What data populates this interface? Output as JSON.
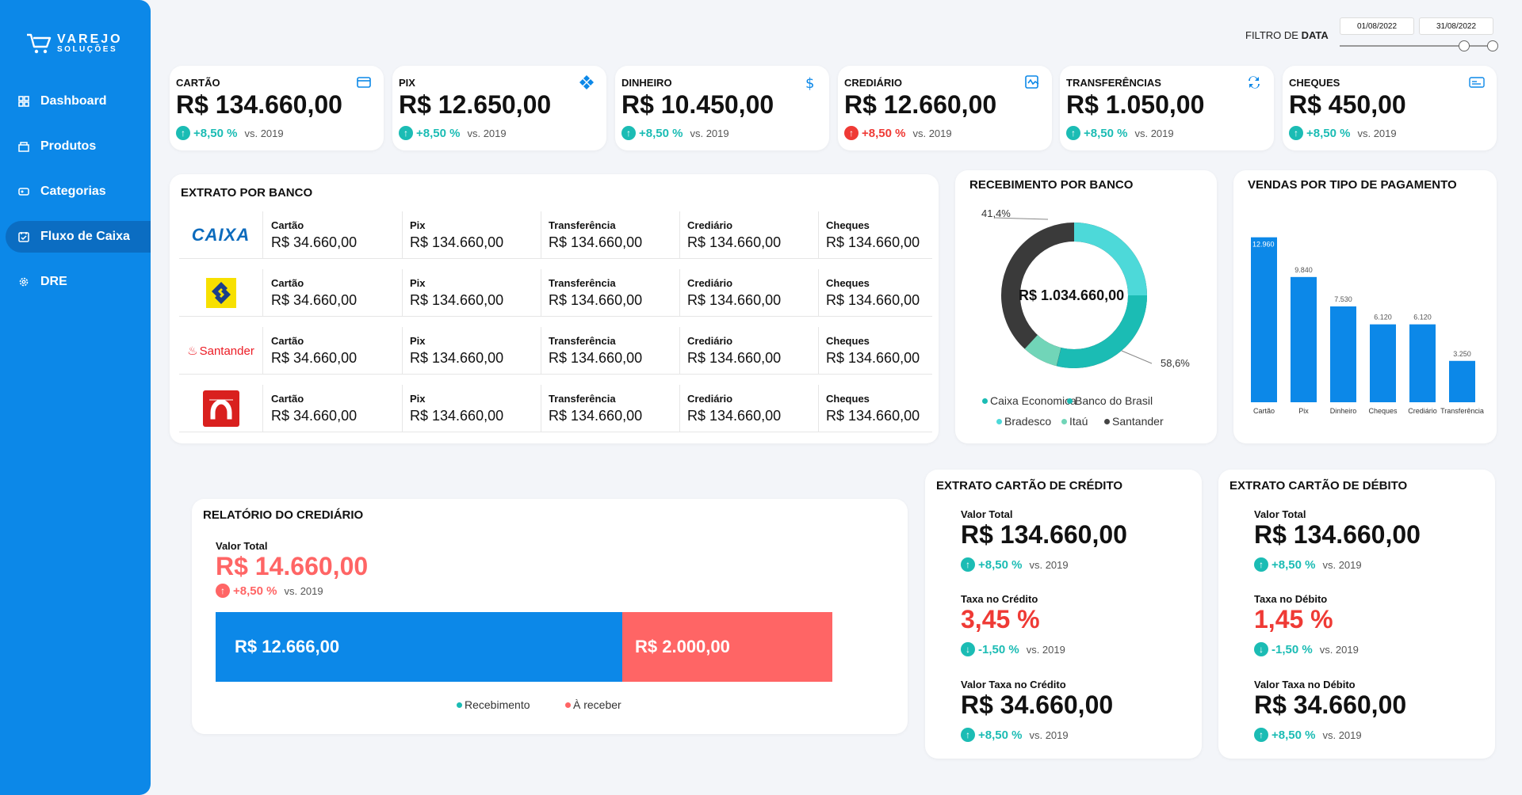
{
  "brand": {
    "line1": "VAREJO",
    "line2": "SOLUÇÕES"
  },
  "nav": [
    {
      "label": "Dashboard",
      "icon": "grid-icon"
    },
    {
      "label": "Produtos",
      "icon": "box-icon"
    },
    {
      "label": "Categorias",
      "icon": "tag-icon"
    },
    {
      "label": "Fluxo de Caixa",
      "icon": "calendar-icon",
      "active": true
    },
    {
      "label": "DRE",
      "icon": "gear-icon"
    }
  ],
  "filter": {
    "label_prefix": "FILTRO DE",
    "label_bold": "DATA",
    "start": "01/08/2022",
    "end": "31/08/2022"
  },
  "kpis": [
    {
      "label": "CARTÃO",
      "value": "R$ 134.660,00",
      "trend": "+8,50 %",
      "direction": "up",
      "vs": "vs. 2019",
      "icon": "credit-card-icon"
    },
    {
      "label": "PIX",
      "value": "R$ 12.650,00",
      "trend": "+8,50 %",
      "direction": "up",
      "vs": "vs. 2019",
      "icon": "pix-icon"
    },
    {
      "label": "DINHEIRO",
      "value": "R$ 10.450,00",
      "trend": "+8,50 %",
      "direction": "up",
      "vs": "vs. 2019",
      "icon": "dollar-icon"
    },
    {
      "label": "CREDIÁRIO",
      "value": "R$ 12.660,00",
      "trend": "+8,50 %",
      "direction": "red",
      "vs": "vs. 2019",
      "icon": "signature-icon"
    },
    {
      "label": "TRANSFERÊNCIAS",
      "value": "R$ 1.050,00",
      "trend": "+8,50 %",
      "direction": "up",
      "vs": "vs. 2019",
      "icon": "transfer-icon"
    },
    {
      "label": "CHEQUES",
      "value": "R$ 450,00",
      "trend": "+8,50 %",
      "direction": "up",
      "vs": "vs. 2019",
      "icon": "check-icon"
    }
  ],
  "extrato_banco": {
    "title": "EXTRATO POR BANCO",
    "columns": [
      "Cartão",
      "Pix",
      "Transferência",
      "Crediário",
      "Cheques"
    ],
    "rows": [
      {
        "bank": "Caixa",
        "logo_text": "CAIXA",
        "values": [
          "R$ 34.660,00",
          "R$ 134.660,00",
          "R$ 134.660,00",
          "R$ 134.660,00",
          "R$ 134.660,00"
        ]
      },
      {
        "bank": "Banco do Brasil",
        "values": [
          "R$ 34.660,00",
          "R$ 134.660,00",
          "R$ 134.660,00",
          "R$ 134.660,00",
          "R$ 134.660,00"
        ]
      },
      {
        "bank": "Santander",
        "logo_text": "Santander",
        "values": [
          "R$ 34.660,00",
          "R$ 134.660,00",
          "R$ 134.660,00",
          "R$ 134.660,00",
          "R$ 134.660,00"
        ]
      },
      {
        "bank": "Bradesco",
        "values": [
          "R$ 34.660,00",
          "R$ 134.660,00",
          "R$ 134.660,00",
          "R$ 134.660,00",
          "R$ 134.660,00"
        ]
      }
    ]
  },
  "recebimento": {
    "title": "RECEBIMENTO POR BANCO",
    "center_value": "R$ 1.034.660,00",
    "label_a": "41,4%",
    "label_b": "58,6%",
    "legend": [
      {
        "name": "Caixa Economica",
        "color": "#1bbcb4"
      },
      {
        "name": "Banco do Brasil",
        "color": "#1bbcb4"
      },
      {
        "name": "Bradesco",
        "color": "#4dd9d9"
      },
      {
        "name": "Itaú",
        "color": "#71d5b8"
      },
      {
        "name": "Santander",
        "color": "#444444"
      }
    ]
  },
  "chart_data": {
    "type": "bar",
    "title": "VENDAS POR TIPO DE PAGAMENTO",
    "categories": [
      "Cartão",
      "Pix",
      "Dinheiro",
      "Cheques",
      "Crediário",
      "Transferência"
    ],
    "values": [
      12960,
      9840,
      7530,
      6120,
      6120,
      3250
    ],
    "value_labels": [
      "12.960",
      "9.840",
      "7.530",
      "6.120",
      "6.120",
      "3.250"
    ],
    "ylim": [
      0,
      13500
    ],
    "color": "#0c88e8"
  },
  "crediario": {
    "title": "RELATÓRIO DO CREDIÁRIO",
    "total_label": "Valor Total",
    "total_value": "R$ 14.660,00",
    "trend": "+8,50 %",
    "vs": "vs. 2019",
    "recebimento_value": "R$ 12.666,00",
    "areceber_value": "R$ 2.000,00",
    "recebimento_share": 0.66,
    "legend_recebimento": "Recebimento",
    "legend_areceber": "À receber",
    "color_recebimento": "#0c88e8",
    "color_areceber": "#ff6565"
  },
  "credito": {
    "title": "EXTRATO CARTÃO DE CRÉDITO",
    "total_label": "Valor Total",
    "total_value": "R$ 134.660,00",
    "total_trend": "+8,50 %",
    "taxa_label": "Taxa no Crédito",
    "taxa_value": "3,45 %",
    "taxa_trend": "-1,50 %",
    "vt_label": "Valor Taxa no Crédito",
    "vt_value": "R$ 34.660,00",
    "vt_trend": "+8,50 %",
    "vs": "vs. 2019"
  },
  "debito": {
    "title": "EXTRATO CARTÃO DE DÉBITO",
    "total_label": "Valor Total",
    "total_value": "R$ 134.660,00",
    "total_trend": "+8,50 %",
    "taxa_label": "Taxa no Débito",
    "taxa_value": "1,45 %",
    "taxa_trend": "-1,50 %",
    "vt_label": "Valor Taxa no Débito",
    "vt_value": "R$ 34.660,00",
    "vt_trend": "+8,50 %",
    "vs": "vs. 2019"
  }
}
